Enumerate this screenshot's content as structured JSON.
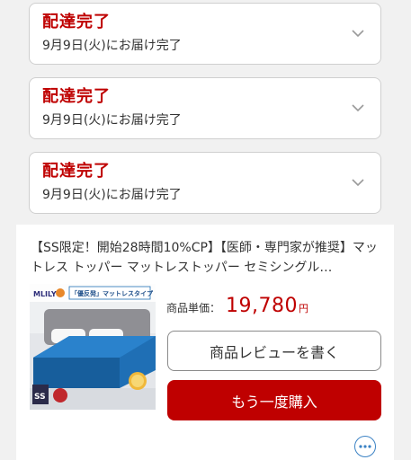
{
  "deliveries": [
    {
      "status": "配達完了",
      "detail": "9月9日(火)にお届け完了"
    },
    {
      "status": "配達完了",
      "detail": "9月9日(火)にお届け完了"
    },
    {
      "status": "配達完了",
      "detail": "9月9日(火)にお届け完了"
    }
  ],
  "product": {
    "title": "【SS限定！開始28時間10%CP】【医師・専門家が推奨】マットレス トッパー マットレストッパー セミシングル…",
    "price_label": "商品単価：",
    "price_value": "19,780",
    "price_unit": "円",
    "image_brand": "MLILY",
    "image_tag": "「優反発」マットレスタイプ",
    "image_size": "SS",
    "review_label": "商品レビューを書く",
    "rebuy_label": "もう一度購入"
  },
  "colors": {
    "accent_red": "#bf0000",
    "mattress_blue": "#1f6fb5",
    "more_blue": "#3b82c4"
  },
  "icons": {
    "expand": "chevron-down-icon",
    "more": "more-horizontal-icon"
  }
}
